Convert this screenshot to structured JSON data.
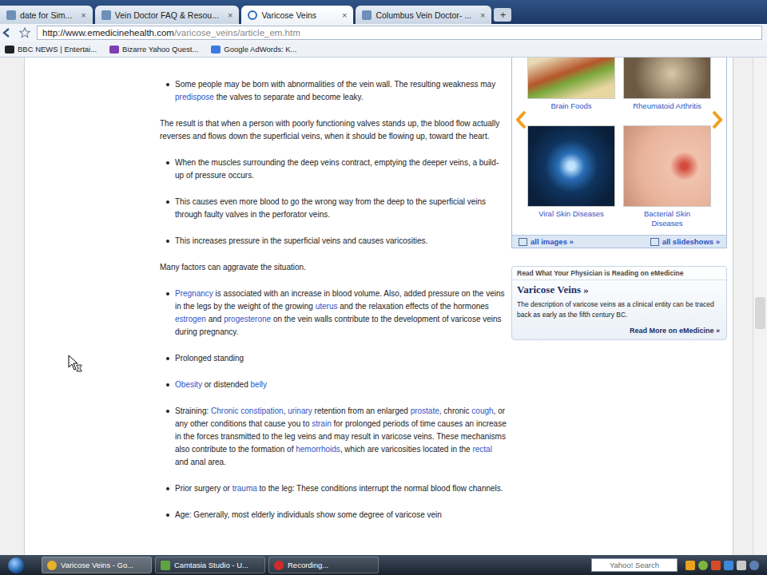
{
  "browser": {
    "tabs": [
      {
        "label": "date for Sim...",
        "close": "×",
        "selected": false
      },
      {
        "label": "Vein Doctor FAQ & Resou...",
        "close": "×",
        "selected": false
      },
      {
        "label": "Varicose Veins",
        "close": "×",
        "selected": true
      },
      {
        "label": "Columbus Vein Doctor- ...",
        "close": "×",
        "selected": false
      }
    ],
    "new_tab": "+",
    "url": {
      "host": "http://www.emedicinehealth.com",
      "path": "/varicose_veins/article_em.htm"
    },
    "bookmarks": [
      "BBC NEWS | Entertai...",
      "Bizarre Yahoo Quest...",
      "Google AdWords: K..."
    ]
  },
  "article": {
    "blocks": [
      {
        "kind": "bullet",
        "segments": [
          {
            "text": "Some people may be born with abnormalities of the vein wall. The resulting weakness may ",
            "link": false
          },
          {
            "text": "predispose",
            "link": true
          },
          {
            "text": " the valves to separate and become leaky.",
            "link": false
          }
        ]
      },
      {
        "kind": "para",
        "segments": [
          {
            "text": "The result is that when a person with poorly functioning valves stands up, the blood flow actually reverses and flows down the superficial veins, when it should be flowing up, toward the heart.",
            "link": false
          }
        ]
      },
      {
        "kind": "bullet",
        "segments": [
          {
            "text": "When the muscles surrounding the deep veins contract, emptying the deeper veins, a build-up of pressure occurs.",
            "link": false
          }
        ]
      },
      {
        "kind": "bullet",
        "segments": [
          {
            "text": "This causes even more blood to go the wrong way from the deep to the superficial veins through faulty valves in the perforator veins.",
            "link": false
          }
        ]
      },
      {
        "kind": "bullet",
        "segments": [
          {
            "text": "This increases pressure in the superficial veins and causes varicosities.",
            "link": false
          }
        ]
      },
      {
        "kind": "para",
        "segments": [
          {
            "text": "Many factors can aggravate the situation.",
            "link": false
          }
        ]
      },
      {
        "kind": "bullet",
        "segments": [
          {
            "text": "Pregnancy",
            "link": true
          },
          {
            "text": " is associated with an increase in blood volume. Also, added pressure on the veins in the legs by the weight of the growing ",
            "link": false
          },
          {
            "text": "uterus",
            "link": true
          },
          {
            "text": " and the relaxation effects of the hormones ",
            "link": false
          },
          {
            "text": "estrogen",
            "link": true
          },
          {
            "text": " and ",
            "link": false
          },
          {
            "text": "progesterone",
            "link": true
          },
          {
            "text": " on the vein walls contribute to the development of varicose veins during pregnancy.",
            "link": false
          }
        ]
      },
      {
        "kind": "bullet",
        "segments": [
          {
            "text": "Prolonged standing",
            "link": false
          }
        ]
      },
      {
        "kind": "bullet",
        "segments": [
          {
            "text": "Obesity",
            "link": true
          },
          {
            "text": " or distended ",
            "link": false
          },
          {
            "text": "belly",
            "link": true
          }
        ]
      },
      {
        "kind": "bullet",
        "segments": [
          {
            "text": "Straining: ",
            "link": false
          },
          {
            "text": "Chronic constipation",
            "link": true
          },
          {
            "text": ", ",
            "link": false
          },
          {
            "text": "urinary",
            "link": true
          },
          {
            "text": " retention from an enlarged ",
            "link": false
          },
          {
            "text": "prostate",
            "link": true
          },
          {
            "text": ", chronic ",
            "link": false
          },
          {
            "text": "cough",
            "link": true
          },
          {
            "text": ", or any other conditions that cause you to ",
            "link": false
          },
          {
            "text": "strain",
            "link": true
          },
          {
            "text": " for prolonged periods of time causes an increase in the forces transmitted to the leg veins and may result in varicose veins. These mechanisms also contribute to the formation of ",
            "link": false
          },
          {
            "text": "hemorrhoids",
            "link": true
          },
          {
            "text": ", which are varicosities located in the ",
            "link": false
          },
          {
            "text": "rectal",
            "link": true
          },
          {
            "text": " and anal area.",
            "link": false
          }
        ]
      },
      {
        "kind": "bullet",
        "segments": [
          {
            "text": "Prior surgery or ",
            "link": false
          },
          {
            "text": "trauma",
            "link": true
          },
          {
            "text": " to the leg: These conditions interrupt the normal blood flow channels.",
            "link": false
          }
        ]
      },
      {
        "kind": "bullet",
        "segments": [
          {
            "text": "Age: Generally, most elderly individuals show some degree of varicose vein",
            "link": false
          }
        ]
      }
    ]
  },
  "slideshow": {
    "items": [
      {
        "caption": "Brain Foods"
      },
      {
        "caption": "Rheumatoid Arthritis"
      },
      {
        "caption": "Viral Skin Diseases"
      },
      {
        "caption": "Bacterial Skin Diseases"
      }
    ],
    "all_images": "all images »",
    "all_slideshows": "all slideshows »"
  },
  "physician_box": {
    "header": "Read What Your Physician is Reading on eMedicine",
    "title": "Varicose Veins »",
    "text": "The description of varicose veins as a clinical entity can be traced back as early as the fifth century BC.",
    "more": "Read More on eMedicine »"
  },
  "taskbar": {
    "items": [
      {
        "label": "Varicose Veins - Go...",
        "selected": true
      },
      {
        "label": "Camtasia Studio - U...",
        "selected": false
      },
      {
        "label": "Recording...",
        "selected": false
      }
    ],
    "search": "Yahoo! Search"
  }
}
